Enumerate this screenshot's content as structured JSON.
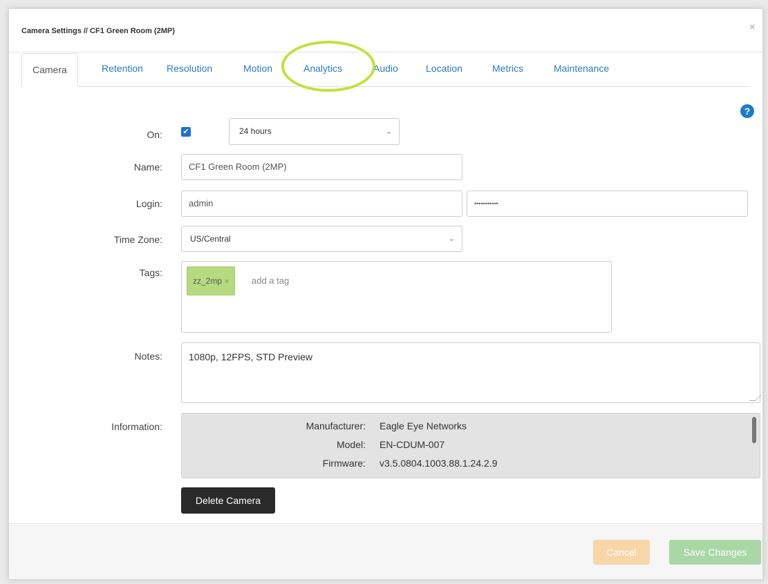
{
  "dialog": {
    "title": "Camera Settings // CF1 Green Room (2MP)",
    "close_icon": "×"
  },
  "tabs": [
    {
      "label": "Camera",
      "active": true
    },
    {
      "label": "Retention"
    },
    {
      "label": "Resolution"
    },
    {
      "label": "Motion"
    },
    {
      "label": "Analytics",
      "highlighted": true
    },
    {
      "label": "Audio"
    },
    {
      "label": "Location"
    },
    {
      "label": "Metrics"
    },
    {
      "label": "Maintenance"
    }
  ],
  "help_icon": "?",
  "form": {
    "on_label": "On:",
    "on_checked": true,
    "check_glyph": "✔",
    "schedule_value": "24 hours",
    "chevron": "⌄",
    "name_label": "Name:",
    "name_value": "CF1 Green Room (2MP)",
    "login_label": "Login:",
    "login_value": "admin",
    "password_value": "•••••••••••",
    "timezone_label": "Time Zone:",
    "timezone_value": "US/Central",
    "tags_label": "Tags:",
    "tags": [
      {
        "label": "zz_2mp",
        "remove": "×"
      }
    ],
    "tag_placeholder": "add a tag",
    "notes_label": "Notes:",
    "notes_value": "1080p, 12FPS, STD Preview",
    "information_label": "Information:"
  },
  "information": [
    {
      "key": "Manufacturer:",
      "value": "Eagle Eye Networks"
    },
    {
      "key": "Model:",
      "value": "EN-CDUM-007"
    },
    {
      "key": "Firmware:",
      "value": "v3.5.0804.1003.88.1.24.2.9"
    }
  ],
  "buttons": {
    "delete": "Delete Camera",
    "cancel": "Cancel",
    "save": "Save Changes"
  },
  "colors": {
    "accent_blue": "#2a7bbf",
    "highlight_ring": "#c5df3a",
    "tag_chip": "#b6da80"
  }
}
